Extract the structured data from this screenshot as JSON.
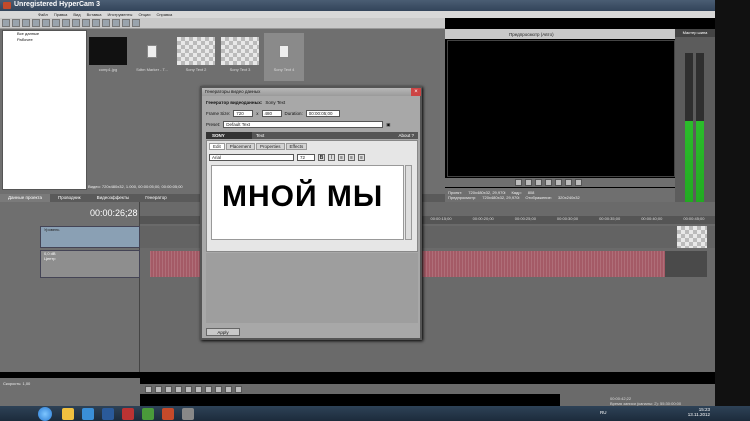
{
  "window": {
    "title": "Unregistered HyperCam 3"
  },
  "menu": [
    "Файл",
    "Правка",
    "Вид",
    "Вставка",
    "Инструменты",
    "Опции",
    "Справка"
  ],
  "tree": {
    "items": [
      "Все данные",
      "Рабочее"
    ]
  },
  "media": [
    {
      "label": "comp1.jpg",
      "kind": "dark"
    },
    {
      "label": "Sdtm Marker - T...",
      "kind": "doc"
    },
    {
      "label": "Sony Text 2",
      "kind": "checker"
    },
    {
      "label": "Sony Text 3",
      "kind": "checker"
    },
    {
      "label": "Sony Text 4",
      "kind": "doc"
    }
  ],
  "media_status": "Видео: 720x480x32, 1.000, 00:00:05;00, 00:00:05;00",
  "tabs": [
    "Данные проекта",
    "Проводник",
    "Видеоэффекты",
    "Генератор"
  ],
  "preview_toolbar": {
    "quality": "Предпросмотр (Авто)"
  },
  "preview_info": {
    "project_label": "Проект:",
    "project_value": "720x480x32, 29,970i",
    "frame_label": "Кадр:",
    "frame_value": "808",
    "preview_label": "Предпросмотр:",
    "preview_value": "720x480x32, 29,970i",
    "display_label": "Отображение:",
    "display_value": "320x240x32"
  },
  "meter": {
    "title": "Мастер шина"
  },
  "timeline": {
    "timecode": "00:00:26;28",
    "ruler": [
      "00:00:15;00",
      "00:00:20;00",
      "00:00:25;00",
      "00:00:30;00",
      "00:00:35;00",
      "00:00:40;00",
      "00:00:45;00"
    ],
    "track1_label": "Уровень",
    "track2_vol": "0,0 dB",
    "track2_pan": "Центр"
  },
  "left_status": {
    "rate": "Скорость: 1,00"
  },
  "right_status": {
    "time": "00:00:42;22",
    "record_time": "Время записи (каналы: 2): 55:30:00:00"
  },
  "dialog": {
    "title": "Генераторы видео данных",
    "gen_label": "Генератор видеоданных:",
    "gen_value": "Sony Text",
    "frame_size_label": "Frame Size:",
    "width": "720",
    "height": "480",
    "duration_label": "Duration:",
    "duration": "00:00:05;00",
    "preset_label": "Preset:",
    "preset": "Default Text",
    "sony_label": "SONY",
    "plugin_label": "Text",
    "about": "About ?",
    "inner_tabs": [
      "Edit",
      "Placement",
      "Properties",
      "Effects"
    ],
    "font": "Arial",
    "size": "72",
    "bold": "B",
    "italic": "I",
    "text": "МНОЙ МЫ",
    "apply": "Apply"
  },
  "taskbar": {
    "lang": "RU",
    "time": "15:23",
    "date": "13.11.2012"
  }
}
